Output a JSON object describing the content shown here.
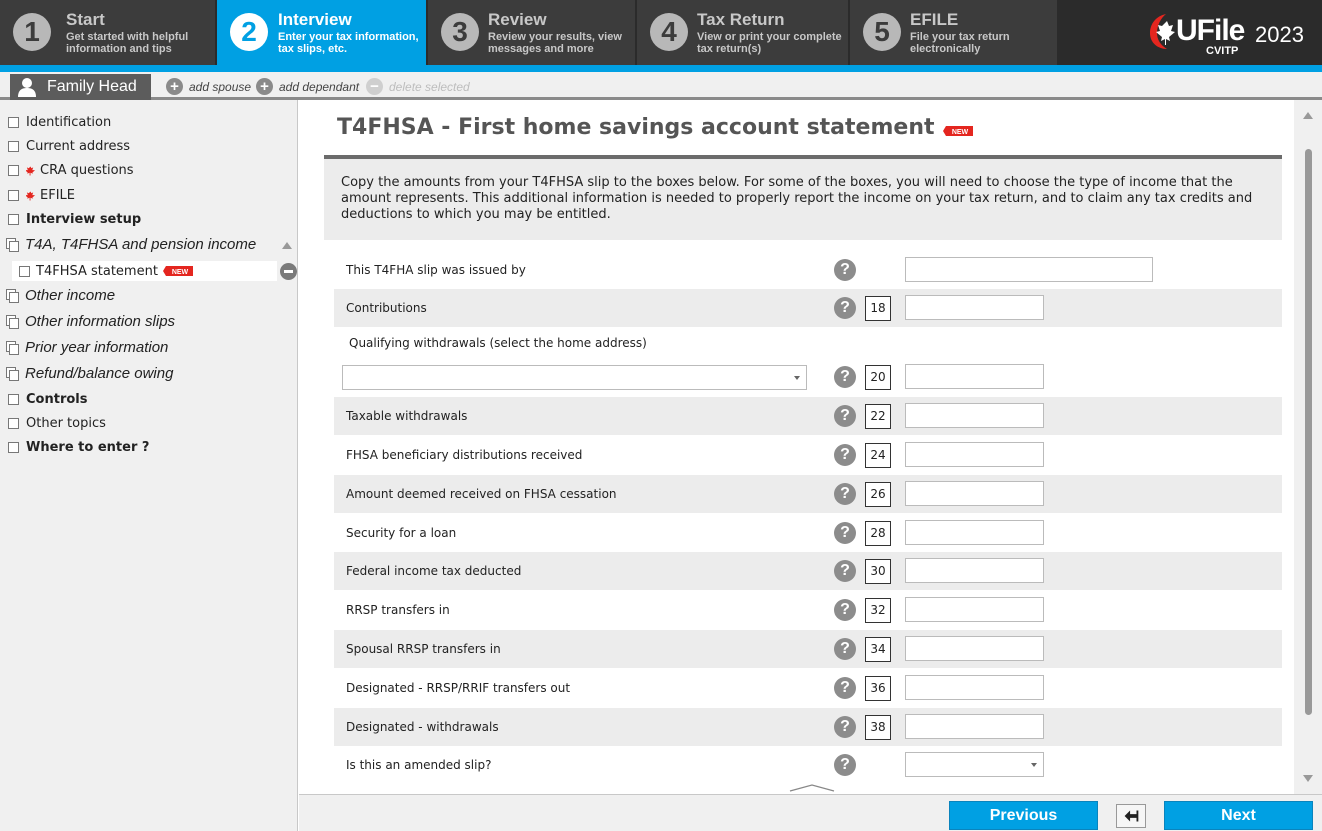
{
  "steps": [
    {
      "num": "1",
      "title": "Start",
      "desc": "Get started with helpful information and tips"
    },
    {
      "num": "2",
      "title": "Interview",
      "desc": "Enter your tax information, tax slips, etc."
    },
    {
      "num": "3",
      "title": "Review",
      "desc": "Review your results, view messages and more"
    },
    {
      "num": "4",
      "title": "Tax Return",
      "desc": "View or print your complete tax return(s)"
    },
    {
      "num": "5",
      "title": "EFILE",
      "desc": "File your tax return electronically"
    }
  ],
  "brand": {
    "name": "UFile",
    "edition": "CVITP",
    "year": "2023",
    "accent": "#00a0e3"
  },
  "person_bar": {
    "family_tab": "Family Head",
    "add_spouse": "add spouse",
    "add_dependant": "add dependant",
    "delete_selected": "delete selected"
  },
  "sidebar": {
    "items": [
      {
        "label": "Identification"
      },
      {
        "label": "Current address"
      },
      {
        "label": "CRA questions"
      },
      {
        "label": "EFILE"
      },
      {
        "label": "Interview setup"
      },
      {
        "label": "T4A, T4FHSA and pension income"
      },
      {
        "label": "T4FHSA statement"
      },
      {
        "label": "Other income"
      },
      {
        "label": "Other information slips"
      },
      {
        "label": "Prior year information"
      },
      {
        "label": "Refund/balance owing"
      },
      {
        "label": "Controls"
      },
      {
        "label": "Other topics"
      },
      {
        "label": "Where to enter ?"
      }
    ]
  },
  "form": {
    "title": "T4FHSA - First home savings account statement",
    "new_badge": "NEW",
    "intro": "Copy the amounts from your T4FHSA slip to the boxes below. For some of the boxes, you will need to choose the type of income that the amount represents. This additional information is needed to properly report the income on your tax return, and to claim any tax credits and deductions to which you may be entitled.",
    "help_glyph": "?",
    "qualifying_label": "Qualifying withdrawals (select the home address)",
    "rows": [
      {
        "label": "This T4FHA slip was issued by",
        "box": "",
        "value": ""
      },
      {
        "label": "Contributions",
        "box": "18",
        "value": ""
      },
      {
        "label": "",
        "box": "20",
        "value": ""
      },
      {
        "label": "Taxable withdrawals",
        "box": "22",
        "value": ""
      },
      {
        "label": "FHSA beneficiary distributions received",
        "box": "24",
        "value": ""
      },
      {
        "label": "Amount deemed received on FHSA cessation",
        "box": "26",
        "value": ""
      },
      {
        "label": "Security for a loan",
        "box": "28",
        "value": ""
      },
      {
        "label": "Federal income tax deducted",
        "box": "30",
        "value": ""
      },
      {
        "label": "RRSP transfers in",
        "box": "32",
        "value": ""
      },
      {
        "label": "Spousal RRSP transfers in",
        "box": "34",
        "value": ""
      },
      {
        "label": "Designated - RRSP/RRIF transfers out",
        "box": "36",
        "value": ""
      },
      {
        "label": "Designated - withdrawals",
        "box": "38",
        "value": ""
      },
      {
        "label": "Is this an amended slip?",
        "box": "",
        "value": ""
      }
    ]
  },
  "buttons": {
    "previous": "Previous",
    "next": "Next"
  }
}
